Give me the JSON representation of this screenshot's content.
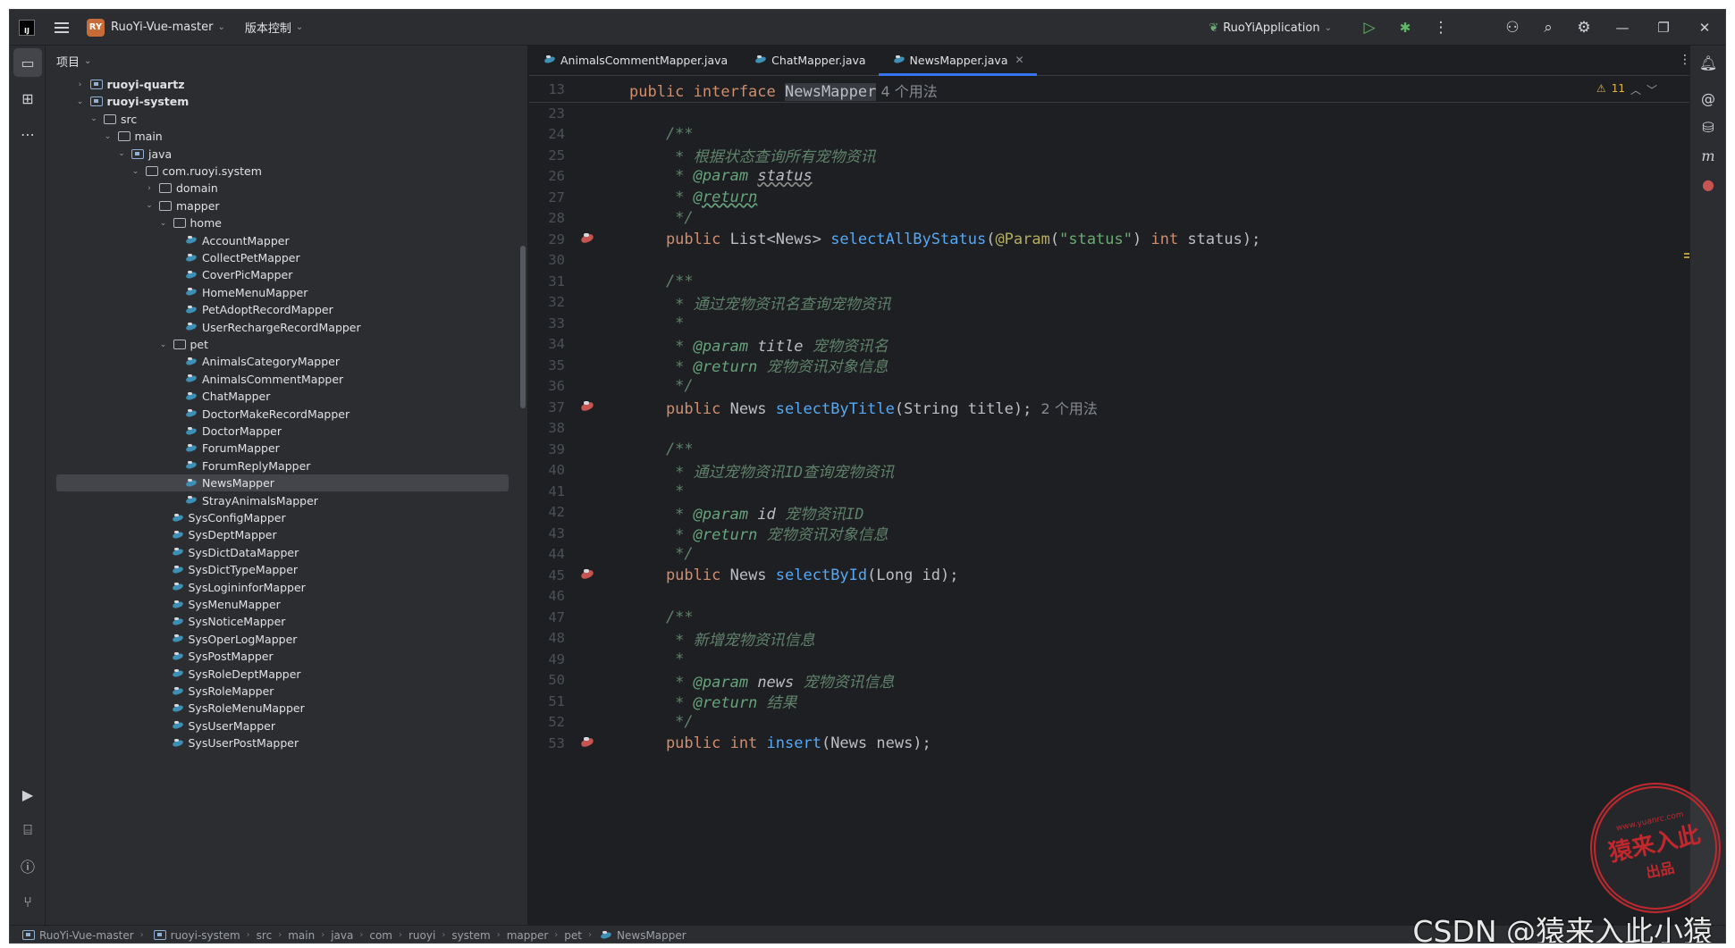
{
  "titlebar": {
    "project_badge": "RY",
    "project_name": "RuoYi-Vue-master",
    "vcs_label": "版本控制",
    "run_config": "RuoYiApplication"
  },
  "project_panel": {
    "header": "项目",
    "tree": [
      {
        "label": "ruoyi-quartz",
        "depth": 1,
        "arrow": "›",
        "kind": "module"
      },
      {
        "label": "ruoyi-system",
        "depth": 1,
        "arrow": "⌄",
        "kind": "module"
      },
      {
        "label": "src",
        "depth": 2,
        "arrow": "⌄",
        "kind": "folder"
      },
      {
        "label": "main",
        "depth": 3,
        "arrow": "⌄",
        "kind": "folder"
      },
      {
        "label": "java",
        "depth": 4,
        "arrow": "⌄",
        "kind": "src"
      },
      {
        "label": "com.ruoyi.system",
        "depth": 5,
        "arrow": "⌄",
        "kind": "folder"
      },
      {
        "label": "domain",
        "depth": 6,
        "arrow": "›",
        "kind": "folder"
      },
      {
        "label": "mapper",
        "depth": 6,
        "arrow": "⌄",
        "kind": "folder"
      },
      {
        "label": "home",
        "depth": 7,
        "arrow": "⌄",
        "kind": "folder"
      },
      {
        "label": "AccountMapper",
        "depth": 8,
        "arrow": "",
        "kind": "mapper"
      },
      {
        "label": "CollectPetMapper",
        "depth": 8,
        "arrow": "",
        "kind": "mapper"
      },
      {
        "label": "CoverPicMapper",
        "depth": 8,
        "arrow": "",
        "kind": "mapper"
      },
      {
        "label": "HomeMenuMapper",
        "depth": 8,
        "arrow": "",
        "kind": "mapper"
      },
      {
        "label": "PetAdoptRecordMapper",
        "depth": 8,
        "arrow": "",
        "kind": "mapper"
      },
      {
        "label": "UserRechargeRecordMapper",
        "depth": 8,
        "arrow": "",
        "kind": "mapper"
      },
      {
        "label": "pet",
        "depth": 7,
        "arrow": "⌄",
        "kind": "folder"
      },
      {
        "label": "AnimalsCategoryMapper",
        "depth": 8,
        "arrow": "",
        "kind": "mapper"
      },
      {
        "label": "AnimalsCommentMapper",
        "depth": 8,
        "arrow": "",
        "kind": "mapper"
      },
      {
        "label": "ChatMapper",
        "depth": 8,
        "arrow": "",
        "kind": "mapper"
      },
      {
        "label": "DoctorMakeRecordMapper",
        "depth": 8,
        "arrow": "",
        "kind": "mapper"
      },
      {
        "label": "DoctorMapper",
        "depth": 8,
        "arrow": "",
        "kind": "mapper"
      },
      {
        "label": "ForumMapper",
        "depth": 8,
        "arrow": "",
        "kind": "mapper"
      },
      {
        "label": "ForumReplyMapper",
        "depth": 8,
        "arrow": "",
        "kind": "mapper"
      },
      {
        "label": "NewsMapper",
        "depth": 8,
        "arrow": "",
        "kind": "mapper",
        "selected": true
      },
      {
        "label": "StrayAnimalsMapper",
        "depth": 8,
        "arrow": "",
        "kind": "mapper"
      },
      {
        "label": "SysConfigMapper",
        "depth": 7,
        "arrow": "",
        "kind": "mapper"
      },
      {
        "label": "SysDeptMapper",
        "depth": 7,
        "arrow": "",
        "kind": "mapper"
      },
      {
        "label": "SysDictDataMapper",
        "depth": 7,
        "arrow": "",
        "kind": "mapper"
      },
      {
        "label": "SysDictTypeMapper",
        "depth": 7,
        "arrow": "",
        "kind": "mapper"
      },
      {
        "label": "SysLogininforMapper",
        "depth": 7,
        "arrow": "",
        "kind": "mapper"
      },
      {
        "label": "SysMenuMapper",
        "depth": 7,
        "arrow": "",
        "kind": "mapper"
      },
      {
        "label": "SysNoticeMapper",
        "depth": 7,
        "arrow": "",
        "kind": "mapper"
      },
      {
        "label": "SysOperLogMapper",
        "depth": 7,
        "arrow": "",
        "kind": "mapper"
      },
      {
        "label": "SysPostMapper",
        "depth": 7,
        "arrow": "",
        "kind": "mapper"
      },
      {
        "label": "SysRoleDeptMapper",
        "depth": 7,
        "arrow": "",
        "kind": "mapper"
      },
      {
        "label": "SysRoleMapper",
        "depth": 7,
        "arrow": "",
        "kind": "mapper"
      },
      {
        "label": "SysRoleMenuMapper",
        "depth": 7,
        "arrow": "",
        "kind": "mapper"
      },
      {
        "label": "SysUserMapper",
        "depth": 7,
        "arrow": "",
        "kind": "mapper"
      },
      {
        "label": "SysUserPostMapper",
        "depth": 7,
        "arrow": "",
        "kind": "mapper"
      }
    ]
  },
  "editor": {
    "tabs": [
      {
        "label": "AnimalsCommentMapper.java",
        "active": false
      },
      {
        "label": "ChatMapper.java",
        "active": false
      },
      {
        "label": "NewsMapper.java",
        "active": true
      }
    ],
    "warning_count": "11",
    "sticky": {
      "num": "13",
      "html_parts": [
        [
          "kw",
          "public interface "
        ],
        [
          "hlt",
          "NewsMapper"
        ],
        [
          "hint",
          "  4 个用法"
        ]
      ]
    },
    "lines": [
      {
        "num": "23",
        "parts": []
      },
      {
        "num": "24",
        "parts": [
          [
            "cm",
            "    /**"
          ]
        ]
      },
      {
        "num": "25",
        "parts": [
          [
            "cm",
            "     * 根据状态查询所有宠物资讯"
          ]
        ]
      },
      {
        "num": "26",
        "parts": [
          [
            "cm",
            "     * "
          ],
          [
            "tg",
            "@param"
          ],
          [
            "pv",
            " "
          ],
          [
            "pvu",
            "status"
          ]
        ]
      },
      {
        "num": "27",
        "parts": [
          [
            "cm",
            "     * "
          ],
          [
            "tgu",
            "@return"
          ]
        ]
      },
      {
        "num": "28",
        "parts": [
          [
            "cm",
            "     */"
          ]
        ]
      },
      {
        "num": "29",
        "mark": true,
        "parts": [
          [
            "kw",
            "    public "
          ],
          [
            "tx",
            "List<News> "
          ],
          [
            "fn",
            "selectAllByStatus"
          ],
          [
            "tx",
            "("
          ],
          [
            "an",
            "@Param"
          ],
          [
            "tx",
            "("
          ],
          [
            "st",
            "\"status\""
          ],
          [
            "tx",
            ") "
          ],
          [
            "kw",
            "int "
          ],
          [
            "tx",
            "status);"
          ]
        ]
      },
      {
        "num": "30",
        "parts": []
      },
      {
        "num": "31",
        "parts": [
          [
            "cm",
            "    /**"
          ]
        ]
      },
      {
        "num": "32",
        "parts": [
          [
            "cm",
            "     * 通过宠物资讯名查询宠物资讯"
          ]
        ]
      },
      {
        "num": "33",
        "parts": [
          [
            "cm",
            "     *"
          ]
        ]
      },
      {
        "num": "34",
        "parts": [
          [
            "cm",
            "     * "
          ],
          [
            "tg",
            "@param "
          ],
          [
            "pv",
            "title "
          ],
          [
            "cm",
            "宠物资讯名"
          ]
        ]
      },
      {
        "num": "35",
        "parts": [
          [
            "cm",
            "     * "
          ],
          [
            "tg",
            "@return "
          ],
          [
            "cm",
            "宠物资讯对象信息"
          ]
        ]
      },
      {
        "num": "36",
        "parts": [
          [
            "cm",
            "     */"
          ]
        ]
      },
      {
        "num": "37",
        "mark": true,
        "parts": [
          [
            "kw",
            "    public "
          ],
          [
            "tx",
            "News "
          ],
          [
            "fn",
            "selectByTitle"
          ],
          [
            "tx",
            "(String title);"
          ],
          [
            "hint",
            "  2 个用法"
          ]
        ]
      },
      {
        "num": "38",
        "parts": []
      },
      {
        "num": "39",
        "parts": [
          [
            "cm",
            "    /**"
          ]
        ]
      },
      {
        "num": "40",
        "parts": [
          [
            "cm",
            "     * 通过宠物资讯ID查询宠物资讯"
          ]
        ]
      },
      {
        "num": "41",
        "parts": [
          [
            "cm",
            "     *"
          ]
        ]
      },
      {
        "num": "42",
        "parts": [
          [
            "cm",
            "     * "
          ],
          [
            "tg",
            "@param "
          ],
          [
            "pv",
            "id "
          ],
          [
            "cm",
            "宠物资讯ID"
          ]
        ]
      },
      {
        "num": "43",
        "parts": [
          [
            "cm",
            "     * "
          ],
          [
            "tg",
            "@return "
          ],
          [
            "cm",
            "宠物资讯对象信息"
          ]
        ]
      },
      {
        "num": "44",
        "parts": [
          [
            "cm",
            "     */"
          ]
        ]
      },
      {
        "num": "45",
        "mark": true,
        "parts": [
          [
            "kw",
            "    public "
          ],
          [
            "tx",
            "News "
          ],
          [
            "fn",
            "selectById"
          ],
          [
            "tx",
            "(Long id);"
          ]
        ]
      },
      {
        "num": "46",
        "parts": []
      },
      {
        "num": "47",
        "parts": [
          [
            "cm",
            "    /**"
          ]
        ]
      },
      {
        "num": "48",
        "parts": [
          [
            "cm",
            "     * 新增宠物资讯信息"
          ]
        ]
      },
      {
        "num": "49",
        "parts": [
          [
            "cm",
            "     *"
          ]
        ]
      },
      {
        "num": "50",
        "parts": [
          [
            "cm",
            "     * "
          ],
          [
            "tg",
            "@param "
          ],
          [
            "pv",
            "news "
          ],
          [
            "cm",
            "宠物资讯信息"
          ]
        ]
      },
      {
        "num": "51",
        "parts": [
          [
            "cm",
            "     * "
          ],
          [
            "tg",
            "@return "
          ],
          [
            "cm",
            "结果"
          ]
        ]
      },
      {
        "num": "52",
        "parts": [
          [
            "cm",
            "     */"
          ]
        ]
      },
      {
        "num": "53",
        "mark": true,
        "parts": [
          [
            "kw",
            "    public int "
          ],
          [
            "fn",
            "insert"
          ],
          [
            "tx",
            "(News news);"
          ]
        ]
      }
    ]
  },
  "breadcrumb": [
    "RuoYi-Vue-master",
    "ruoyi-system",
    "src",
    "main",
    "java",
    "com",
    "ruoyi",
    "system",
    "mapper",
    "pet",
    "NewsMapper"
  ],
  "watermark": {
    "csdn": "CSDN @猿来入此小猿",
    "stamp_url": "www.yuanrc.com",
    "stamp_big": "猿来入此",
    "stamp_small": "出品"
  }
}
